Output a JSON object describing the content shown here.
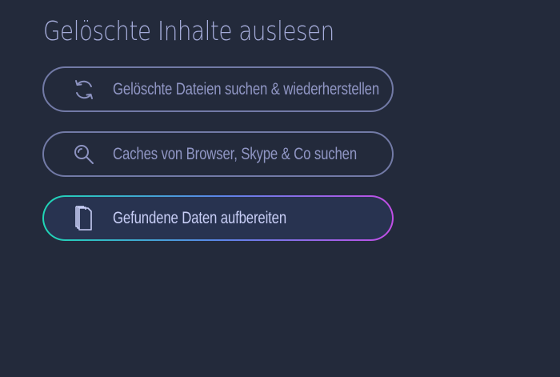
{
  "page": {
    "title": "Gelöschte Inhalte auslesen"
  },
  "buttons": [
    {
      "label": "Gelöschte Dateien suchen & wiederherstellen",
      "icon": "refresh-icon",
      "active": false
    },
    {
      "label": "Caches von Browser, Skype & Co suchen",
      "icon": "search-icon",
      "active": false
    },
    {
      "label": "Gefundene Daten aufbereiten",
      "icon": "documents-icon",
      "active": true
    }
  ],
  "colors": {
    "background": "#232a3b",
    "title": "#a6addb",
    "button_border": "#727aa6",
    "button_text": "#9096c4",
    "active_gradient_start": "#1fd6b5",
    "active_gradient_end": "#c24ee6",
    "active_fill": "#283350"
  }
}
